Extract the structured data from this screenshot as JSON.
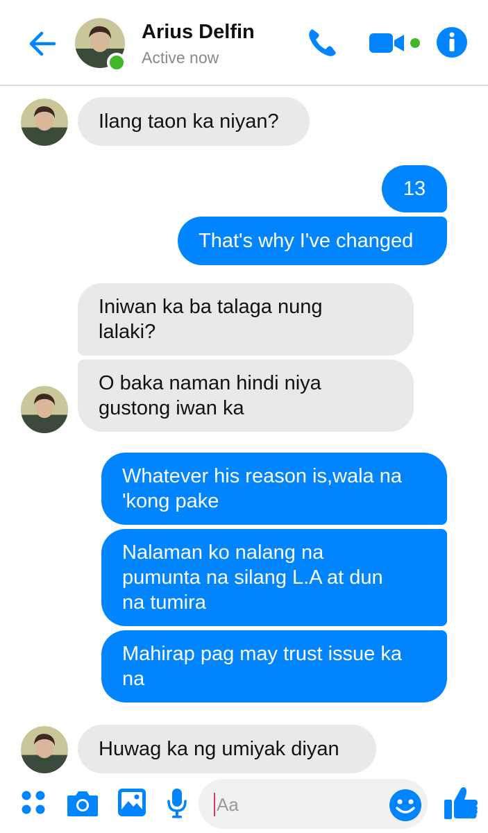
{
  "header": {
    "name": "Arius Delfin",
    "status": "Active now"
  },
  "colors": {
    "accent": "#0084ff",
    "online": "#42b72a",
    "incoming_bubble": "#e9e9eb"
  },
  "messages": [
    {
      "direction": "incoming",
      "lines": [
        "Ilang taon ka niyan?"
      ]
    },
    {
      "direction": "outgoing",
      "lines": [
        "13"
      ]
    },
    {
      "direction": "outgoing",
      "lines": [
        "That's why I've changed"
      ]
    },
    {
      "direction": "incoming",
      "lines": [
        "Iniwan ka ba talaga nung",
        "lalaki?"
      ]
    },
    {
      "direction": "incoming",
      "lines": [
        "O baka naman hindi niya",
        "gustong iwan ka"
      ]
    },
    {
      "direction": "outgoing",
      "lines": [
        "Whatever his reason is,wala na",
        "'kong pake"
      ]
    },
    {
      "direction": "outgoing",
      "lines": [
        "Nalaman ko nalang na",
        "pumunta na silang L.A at dun",
        "na tumira"
      ]
    },
    {
      "direction": "outgoing",
      "lines": [
        "Mahirap pag may trust issue ka",
        "na"
      ]
    },
    {
      "direction": "incoming",
      "lines": [
        "Huwag ka ng umiyak diyan"
      ]
    }
  ],
  "composer": {
    "placeholder": "Aa"
  },
  "icons": [
    "back-arrow-icon",
    "phone-icon",
    "video-camera-icon",
    "info-icon",
    "apps-grid-icon",
    "camera-icon",
    "image-icon",
    "microphone-icon",
    "emoji-icon",
    "thumbs-up-icon"
  ]
}
